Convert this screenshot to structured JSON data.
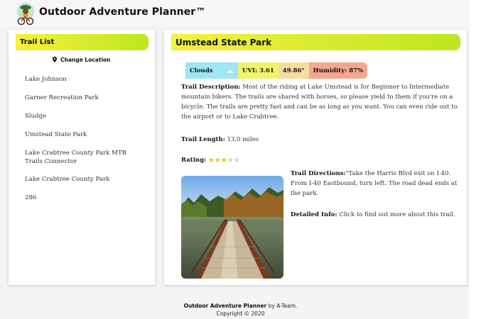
{
  "header": {
    "title": "Outdoor Adventure Planner™"
  },
  "sidebar": {
    "heading": "Trail List",
    "change_location": "Change Location",
    "trails": [
      "Lake Johnson",
      "Garner Recreation Park",
      "Sludge",
      "Umstead State Park",
      "Lake Crabtree County Park MTB Trails Connector",
      "Lake Crabtree County Park",
      "286"
    ]
  },
  "trail": {
    "name": "Umstead State Park",
    "weather": {
      "condition": "Clouds",
      "uvi": "UVI: 3.61",
      "temp": "49.86°",
      "humidity": "Humidity: 87%"
    },
    "description_label": "Trail Description:",
    "description": "Most of the riding at Lake Umstead is for Beginner to Intermediate mountain bikers. The trails are shared with horses, so please yield to them if you're on a bicycle. The trails are pretty fast and can be as long as you want. You can even ride out to the airport or to Lake Crabtree.",
    "length_label": "Trail Length:",
    "length": "13.0 miles",
    "rating_label": "Rating:",
    "rating_value": 3,
    "rating_max": 5,
    "directions_label": "Trail Directions:",
    "directions": "\"Take the Harris Blvd exit on I-40. From I-40 Eastbound, turn left. The road dead ends at the park.",
    "detailed_label": "Detailed Info:",
    "detailed_text": "Click to find out more about this trail."
  },
  "footer": {
    "brand": "Outdoor Adventure Planner",
    "byline": "by A-Team.",
    "copyright": "Copyright © 2020"
  },
  "colors": {
    "header_gradient_start": "#f7f03e",
    "header_gradient_end": "#bde61e",
    "star_on": "#f2c200",
    "star_off": "#cfcfcf"
  }
}
